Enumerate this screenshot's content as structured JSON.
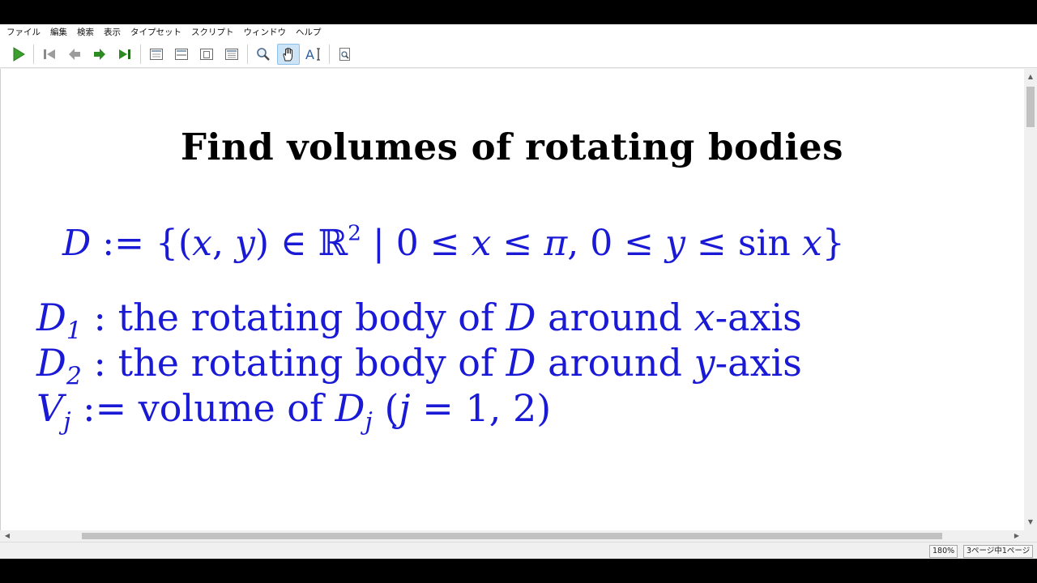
{
  "menu": [
    "ファイル",
    "編集",
    "検索",
    "表示",
    "タイプセット",
    "スクリプト",
    "ウィンドウ",
    "ヘルプ"
  ],
  "toolbar": [
    {
      "name": "typeset-icon",
      "color": "#3ca02c"
    },
    {
      "name": "first-page-icon",
      "color": "#8a8a8a"
    },
    {
      "name": "previous-page-icon",
      "color": "#8a8a8a"
    },
    {
      "name": "next-page-icon",
      "color": "#2e8b22"
    },
    {
      "name": "last-page-icon",
      "color": "#2e8b22"
    },
    {
      "name": "actual-size-icon"
    },
    {
      "name": "fit-width-icon"
    },
    {
      "name": "fit-page-icon"
    },
    {
      "name": "fit-window-icon"
    },
    {
      "name": "magnifier-icon"
    },
    {
      "name": "hand-tool-icon",
      "active": true
    },
    {
      "name": "select-text-icon"
    },
    {
      "name": "document-search-icon"
    }
  ],
  "document": {
    "title": "Find volumes of rotating bodies",
    "domain": {
      "D": "D",
      "assign": ":=",
      "lbrace": "{",
      "lparen": "(",
      "x": "x",
      "comma": ",",
      "y": "y",
      "rparen": ")",
      "in": "∈",
      "R": "ℝ",
      "sq": "2",
      "bar": "|",
      "zero": "0",
      "le": "≤",
      "pi": "π",
      "sin": "sin",
      "rbrace": "}"
    },
    "line1": {
      "D": "D",
      "sub": "1",
      "text": ": the rotating body of",
      "D2": "D",
      "around": "around",
      "axis_var": "x",
      "axis_suffix": "-axis"
    },
    "line2": {
      "D": "D",
      "sub": "2",
      "text": ": the rotating body of",
      "D2": "D",
      "around": "around",
      "axis_var": "y",
      "axis_suffix": "-axis"
    },
    "line3": {
      "V": "V",
      "sub": "j",
      "assign": ":= volume of",
      "D": "D",
      "sub2": "j",
      "paren_open": "(",
      "j": "j",
      "rest": "= 1, 2",
      "paren_close": ")"
    }
  },
  "status": {
    "zoom": "180%",
    "page": "3ページ中1ページ"
  },
  "colors": {
    "math_blue": "#1a1ad6",
    "title_black": "#000000",
    "active_tool": "#cde4f7"
  }
}
